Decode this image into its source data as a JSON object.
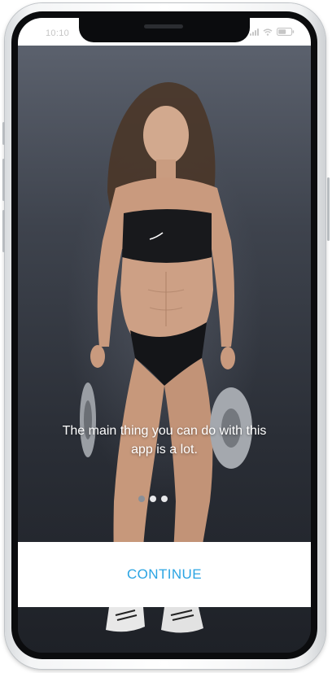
{
  "status_bar": {
    "time": "10:10"
  },
  "onboarding": {
    "message": "The main thing you can do with this app is a lot.",
    "page_indicator": {
      "total_pages": 3,
      "active_page": 2
    },
    "continue_label": "CONTINUE"
  },
  "colors": {
    "accent": "#2aa4e3",
    "background_dark": "#2a2e36",
    "button_background": "#ffffff",
    "dot_active": "#e8e9eb",
    "dot_inactive": "#8a8f97"
  },
  "icons": {
    "status": [
      "signal-icon",
      "wifi-icon",
      "battery-icon"
    ]
  }
}
